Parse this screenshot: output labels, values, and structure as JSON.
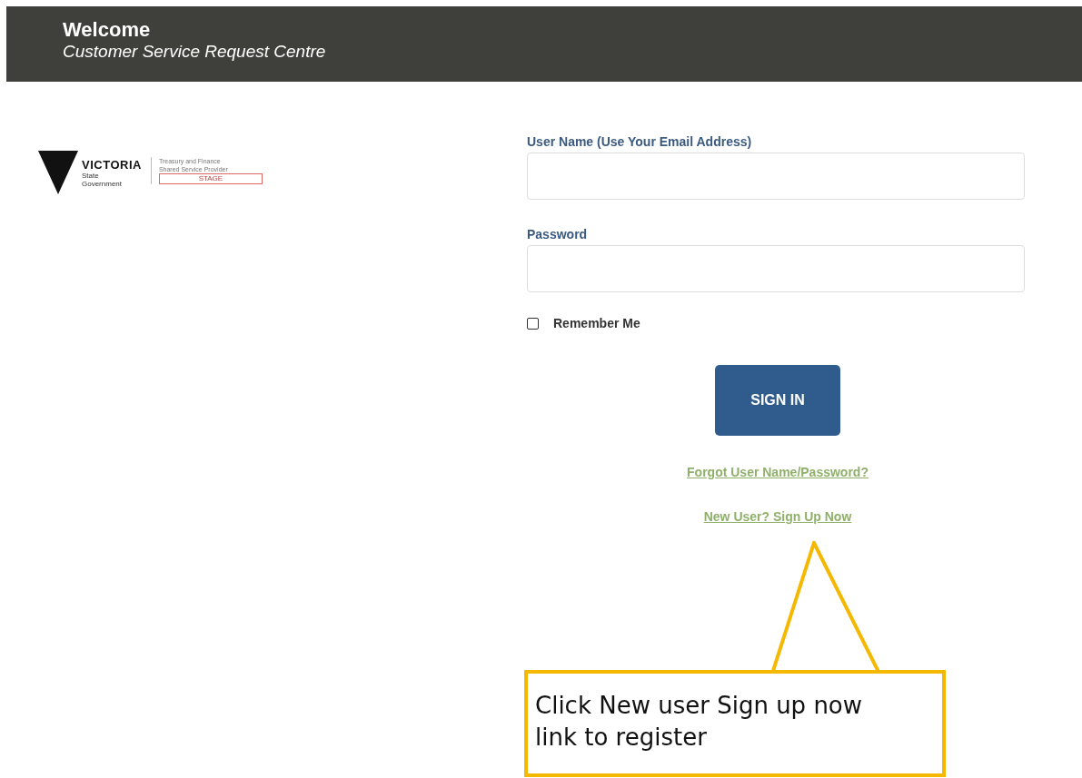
{
  "header": {
    "title": "Welcome",
    "subtitle": "Customer Service Request Centre"
  },
  "logo": {
    "wordmark": "VICTORIA",
    "sub_1": "State",
    "sub_2": "Government",
    "dept_1": "Treasury and Finance",
    "dept_2": "Shared Service Provider",
    "stage": "STAGE"
  },
  "form": {
    "username_label": "User Name (Use Your Email Address)",
    "password_label": "Password",
    "remember": {
      "label": "Remember Me",
      "checked": false
    },
    "sign_in": "SIGN IN",
    "forgot_link": "Forgot User Name/Password?",
    "signup_link": "New User? Sign Up Now"
  },
  "callout": {
    "text": "Click New user Sign up now link to register"
  }
}
